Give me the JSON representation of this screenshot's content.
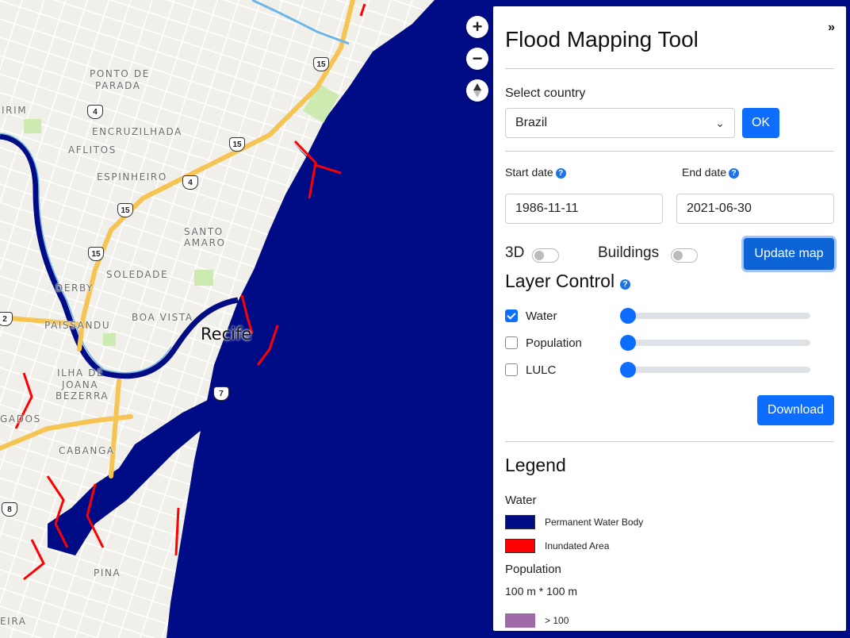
{
  "map": {
    "city_label": "Recife",
    "neighborhoods": [
      "PONTO DE",
      "PARADA",
      "IRIM",
      "ENCRUZILHADA",
      "AFLITOS",
      "ESPINHEIRO",
      "SANTO",
      "AMARO",
      "SOLEDADE",
      "DERBY",
      "BOA VISTA",
      "PAISSANDU",
      "ILHA DE",
      "JOANA",
      "BEZERRA",
      "GADOS",
      "CABANGA",
      "PINA",
      "EIRA"
    ],
    "road_shields": [
      "15",
      "4",
      "15",
      "4",
      "15",
      "15",
      "7",
      "2",
      "8"
    ],
    "controls": {
      "zoom_in": "+",
      "zoom_out": "−"
    },
    "colors": {
      "water": "#000c85",
      "inundated": "#ff0000",
      "land": "#f1efea",
      "road_major": "#f6c452",
      "river_edge": "#6fb6e8",
      "park": "#cdebb0"
    }
  },
  "panel": {
    "title": "Flood Mapping Tool",
    "collapse_glyph": "»",
    "country": {
      "label": "Select country",
      "value": "Brazil",
      "ok": "OK"
    },
    "dates": {
      "start_label": "Start date",
      "start_value": "1986-11-11",
      "end_label": "End date",
      "end_value": "2021-06-30",
      "help": "?"
    },
    "toggles": {
      "three_d": "3D",
      "buildings": "Buildings",
      "update": "Update map"
    },
    "layer_control": {
      "title": "Layer Control",
      "layers": [
        {
          "name": "Water",
          "checked": true,
          "opacity": 1
        },
        {
          "name": "Population",
          "checked": false,
          "opacity": 1
        },
        {
          "name": "LULC",
          "checked": false,
          "opacity": 1
        }
      ],
      "download": "Download"
    },
    "legend": {
      "title": "Legend",
      "water": {
        "heading": "Water",
        "items": [
          {
            "label": "Permanent Water Body",
            "color": "#000c85"
          },
          {
            "label": "Inundated Area",
            "color": "#ff0000"
          }
        ]
      },
      "population": {
        "heading": "Population",
        "unit": "100 m * 100 m",
        "items": [
          {
            "label": "> 100",
            "color": "#a06aa8"
          }
        ]
      }
    }
  }
}
